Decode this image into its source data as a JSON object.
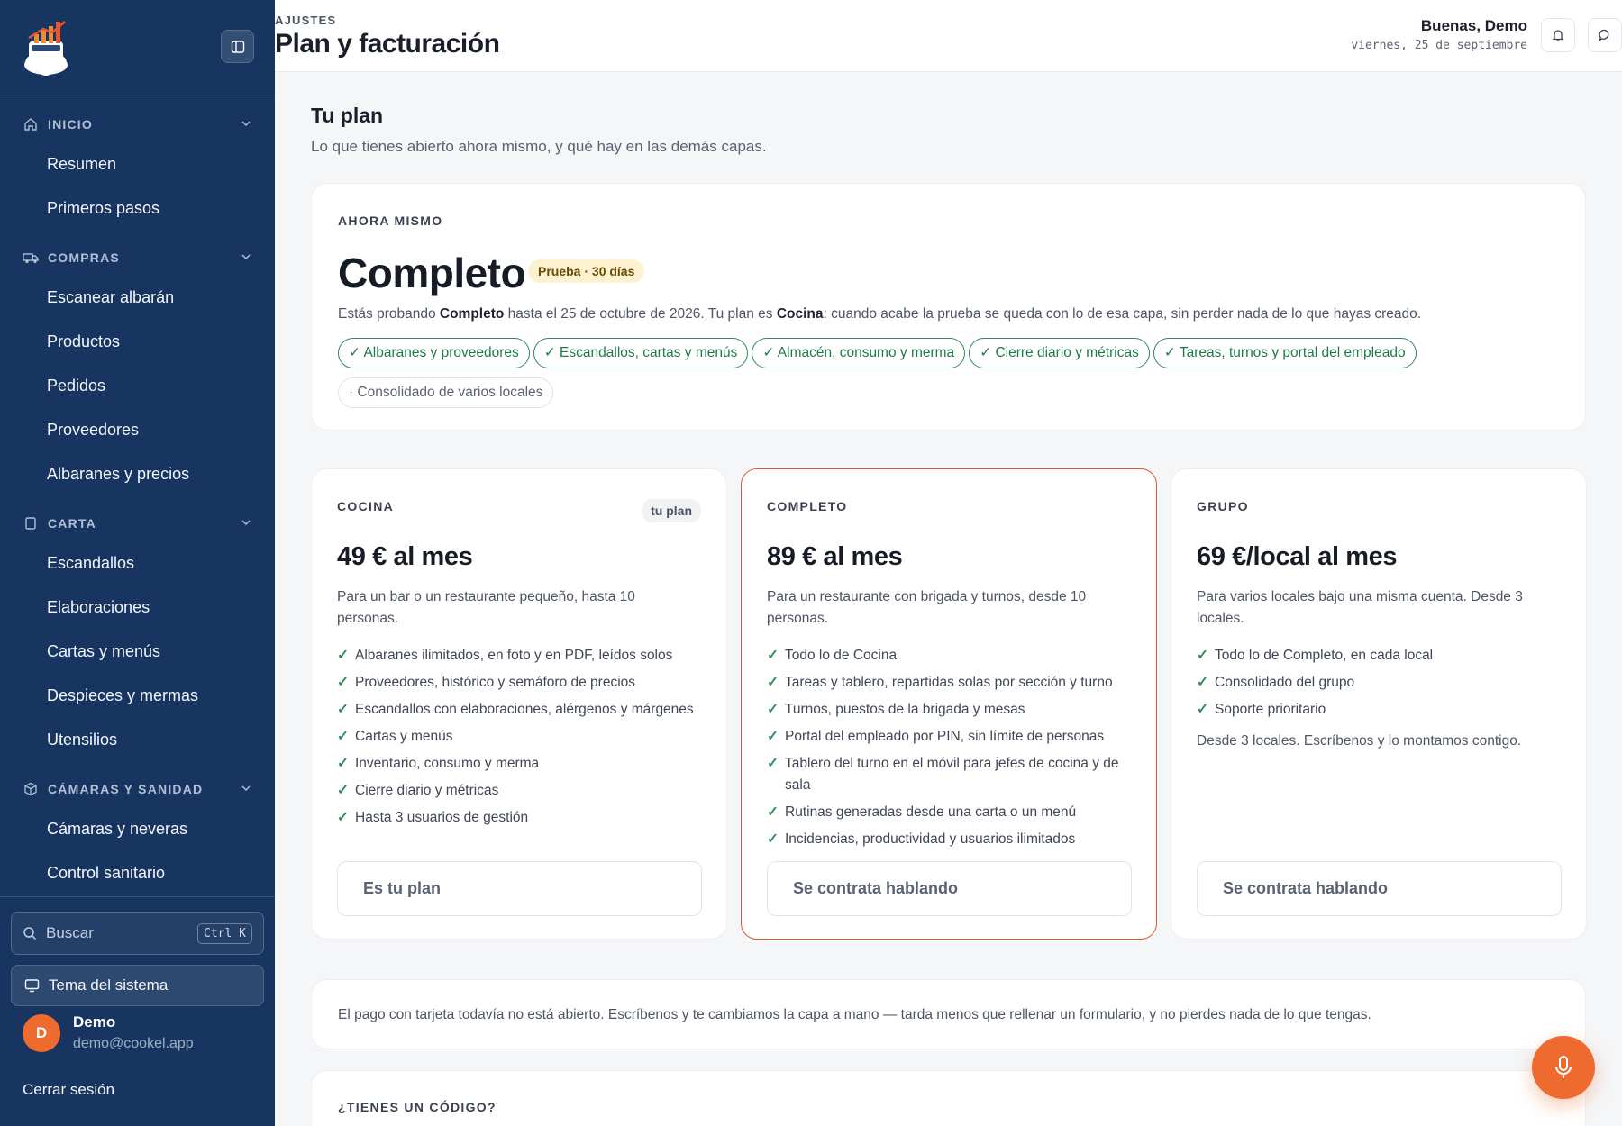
{
  "sidebar": {
    "search_placeholder": "Buscar",
    "search_shortcut": "Ctrl K",
    "theme_label": "Tema del sistema",
    "user": {
      "initial": "D",
      "name": "Demo",
      "email": "demo@cookel.app"
    },
    "logout_label": "Cerrar sesión",
    "groups": [
      {
        "title": "INICIO",
        "items": [
          "Resumen",
          "Primeros pasos"
        ]
      },
      {
        "title": "COMPRAS",
        "items": [
          "Escanear albarán",
          "Productos",
          "Pedidos",
          "Proveedores",
          "Albaranes y precios"
        ]
      },
      {
        "title": "CARTA",
        "items": [
          "Escandallos",
          "Elaboraciones",
          "Cartas y menús",
          "Despieces y mermas",
          "Utensilios"
        ]
      },
      {
        "title": "CÁMARAS Y SANIDAD",
        "items": [
          "Cámaras y neveras",
          "Control sanitario"
        ]
      }
    ]
  },
  "header": {
    "breadcrumb": "AJUSTES",
    "title": "Plan y facturación",
    "greeting": "Buenas, Demo",
    "date": "viernes, 25 de septiembre"
  },
  "main": {
    "section_title": "Tu plan",
    "section_subtitle": "Lo que tienes abierto ahora mismo, y qué hay en las demás capas.",
    "current": {
      "label": "AHORA MISMO",
      "plan": "Completo",
      "badge": "Prueba · 30 días",
      "desc_1": "Estás probando ",
      "desc_plan": "Completo",
      "desc_2": " hasta el 25 de octubre de 2026. Tu plan es ",
      "desc_base": "Cocina",
      "desc_3": ": cuando acabe la prueba se queda con lo de esa capa, sin perder nada de lo que hayas creado.",
      "chips": [
        "✓ Albaranes y proveedores",
        "✓ Escandallos, cartas y menús",
        "✓ Almacén, consumo y merma",
        "✓ Cierre diario y métricas",
        "✓ Tareas, turnos y portal del empleado"
      ],
      "chip_off": "· Consolidado de varios locales"
    },
    "tiers": [
      {
        "name": "COCINA",
        "badge": "tu plan",
        "price": "49 € al mes",
        "desc": "Para un bar o un restaurante pequeño, hasta 10 personas.",
        "features": [
          "Albaranes ilimitados, en foto y en PDF, leídos solos",
          "Proveedores, histórico y semáforo de precios",
          "Escandallos con elaboraciones, alérgenos y márgenes",
          "Cartas y menús",
          "Inventario, consumo y merma",
          "Cierre diario y métricas",
          "Hasta 3 usuarios de gestión"
        ],
        "button": "Es tu plan"
      },
      {
        "name": "COMPLETO",
        "price": "89 € al mes",
        "desc": "Para un restaurante con brigada y turnos, desde 10 personas.",
        "features": [
          "Todo lo de Cocina",
          "Tareas y tablero, repartidas solas por sección y turno",
          "Turnos, puestos de la brigada y mesas",
          "Portal del empleado por PIN, sin límite de personas",
          "Tablero del turno en el móvil para jefes de cocina y de sala",
          "Rutinas generadas desde una carta o un menú",
          "Incidencias, productividad y usuarios ilimitados"
        ],
        "button": "Se contrata hablando"
      },
      {
        "name": "GRUPO",
        "price": "69 €/local al mes",
        "desc": "Para varios locales bajo una misma cuenta. Desde 3 locales.",
        "features": [
          "Todo lo de Completo, en cada local",
          "Consolidado del grupo",
          "Soporte prioritario"
        ],
        "note": "Desde 3 locales. Escríbenos y lo montamos contigo.",
        "button": "Se contrata hablando"
      }
    ],
    "check": "✓",
    "payment_note": "El pago con tarjeta todavía no está abierto. Escríbenos y te cambiamos la capa a mano — tarda menos que rellenar un formulario, y no pierdes nada de lo que tengas.",
    "code_label": "¿TIENES UN CÓDIGO?"
  },
  "colors": {
    "sidebar_bg": "#173560",
    "accent": "#ef6a2f",
    "highlight_border": "#e4572e",
    "check_green": "#2e8b57"
  },
  "icons": [
    "logo-icon",
    "sidebar-toggle-icon",
    "home-icon",
    "truck-icon",
    "book-icon",
    "box-icon",
    "chevron-down-icon",
    "search-icon",
    "monitor-icon",
    "bell-icon",
    "chat-icon",
    "microphone-icon"
  ]
}
